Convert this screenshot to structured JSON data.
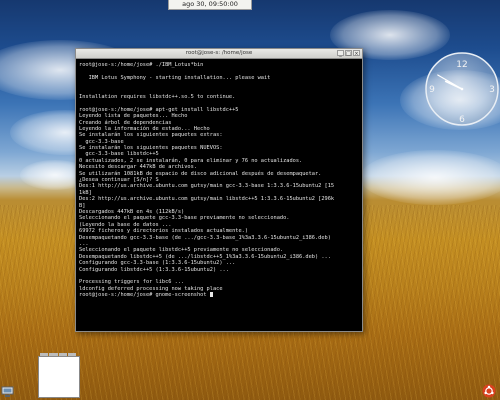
{
  "top_panel": {
    "clock_text": "ago 30, 09:50:00"
  },
  "terminal": {
    "title": "root@jose-s: /home/jose",
    "buttons": [
      "_",
      "□",
      "×"
    ],
    "lines": [
      "root@jose-s:/home/jose# ./IBM_Lotus*bin",
      "",
      "   IBM Lotus Symphony - starting installation... please wait",
      "",
      "",
      "Installation requires libstdc++.so.5 to continue.",
      "",
      "root@jose-s:/home/jose# apt-get install libstdc++5",
      "Leyendo lista de paquetes... Hecho",
      "Creando árbol de dependencias",
      "Leyendo la información de estado... Hecho",
      "Se instalarán los siguientes paquetes extras:",
      "  gcc-3.3-base",
      "Se instalarán los siguientes paquetes NUEVOS:",
      "  gcc-3.3-base libstdc++5",
      "0 actualizados, 2 se instalarán, 0 para eliminar y 76 no actualizados.",
      "Necesito descargar 447kB de archivos.",
      "Se utilizarán 1081kB de espacio de disco adicional después de desempaquetar.",
      "¿Desea continuar [S/n]? S",
      "Des:1 http://us.archive.ubuntu.com gutsy/main gcc-3.3-base 1:3.3.6-15ubuntu2 [15",
      "1kB]",
      "Des:2 http://us.archive.ubuntu.com gutsy/main libstdc++5 1:3.3.6-15ubuntu2 [296k",
      "B]",
      "Descargados 447kB en 4s (112kB/s)",
      "Seleccionando el paquete gcc-3.3-base previamente no seleccionado.",
      "(Leyendo la base de datos ...",
      "69972 ficheros y directorios instalados actualmente.)",
      "Desempaquetando gcc-3.3-base (de .../gcc-3.3-base_1%3a3.3.6-15ubuntu2_i386.deb)",
      "...",
      "Seleccionando el paquete libstdc++5 previamente no seleccionado.",
      "Desempaquetando libstdc++5 (de .../libstdc++5_1%3a3.3.6-15ubuntu2_i386.deb) ...",
      "Configurando gcc-3.3-base (1:3.3.6-15ubuntu2) ...",
      "Configurando libstdc++5 (1:3.3.6-15ubuntu2) ...",
      "",
      "Processing triggers for libc6 ...",
      "ldconfig deferred processing now taking place",
      "root@jose-s:/home/jose# gnome-screenshot"
    ]
  },
  "analog_clock": {
    "numerals": [
      "12",
      "3",
      "6",
      "9"
    ],
    "hour": 9,
    "minute": 50
  },
  "icons": {
    "corner": "monitor-icon",
    "tray": "ubuntu-logo-icon"
  }
}
